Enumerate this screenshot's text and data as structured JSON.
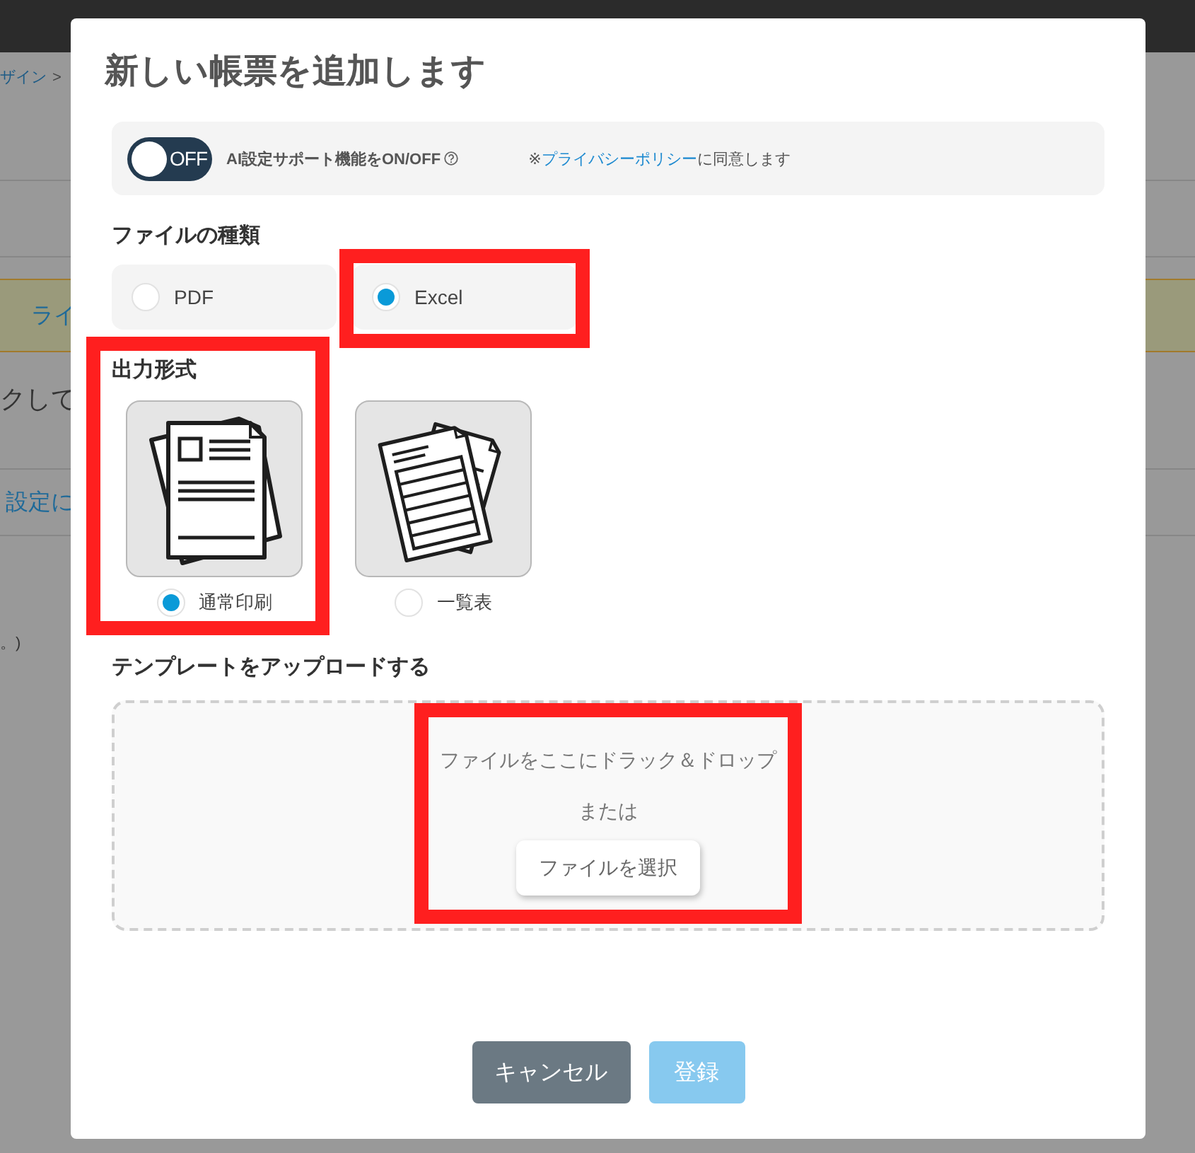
{
  "background_page": {
    "breadcrumb": "ザイン",
    "breadcrumb_separator": ">",
    "notice_link": "ライ",
    "body_text": "クして",
    "settings_link": "設定に",
    "note_text": "。)"
  },
  "dialog": {
    "title": "新しい帳票を追加します",
    "ai_support": {
      "toggle": {
        "on": false,
        "text": "OFF"
      },
      "label": "AI設定サポート機能をON/OFF",
      "consent_prefix": "※",
      "consent_link": "プライバシーポリシー",
      "consent_suffix": "に同意します"
    },
    "file_type": {
      "label": "ファイルの種類",
      "options": [
        {
          "label": "PDF",
          "selected": false,
          "highlighted": false
        },
        {
          "label": "Excel",
          "selected": true,
          "highlighted": true
        }
      ]
    },
    "output_format": {
      "label": "出力形式",
      "highlighted": true,
      "options": [
        {
          "kind": "document",
          "label": "通常印刷",
          "selected": true
        },
        {
          "kind": "table",
          "label": "一覧表",
          "selected": false
        }
      ]
    },
    "upload": {
      "label": "テンプレートをアップロードする",
      "drop_text": "ファイルをここにドラック＆ドロップ",
      "or_text": "または",
      "button": "ファイルを選択",
      "highlighted": true
    },
    "buttons": [
      {
        "kind": "cancel",
        "label": "キャンセル",
        "disabled": false
      },
      {
        "kind": "submit",
        "label": "登録",
        "disabled": true
      }
    ]
  }
}
